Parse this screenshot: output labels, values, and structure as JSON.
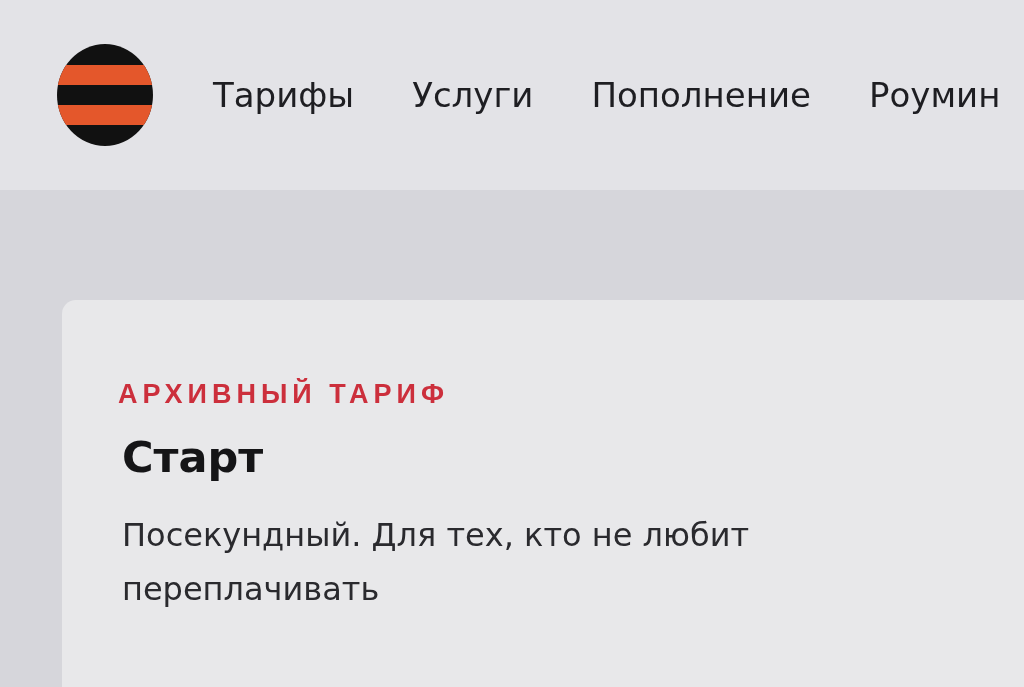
{
  "header": {
    "nav": [
      "Тарифы",
      "Услуги",
      "Пополнение",
      "Роумин"
    ]
  },
  "card": {
    "badge": "АРХИВНЫЙ ТАРИФ",
    "title": "Старт",
    "description": "Посекундный. Для тех, кто не любит переплачивать"
  }
}
